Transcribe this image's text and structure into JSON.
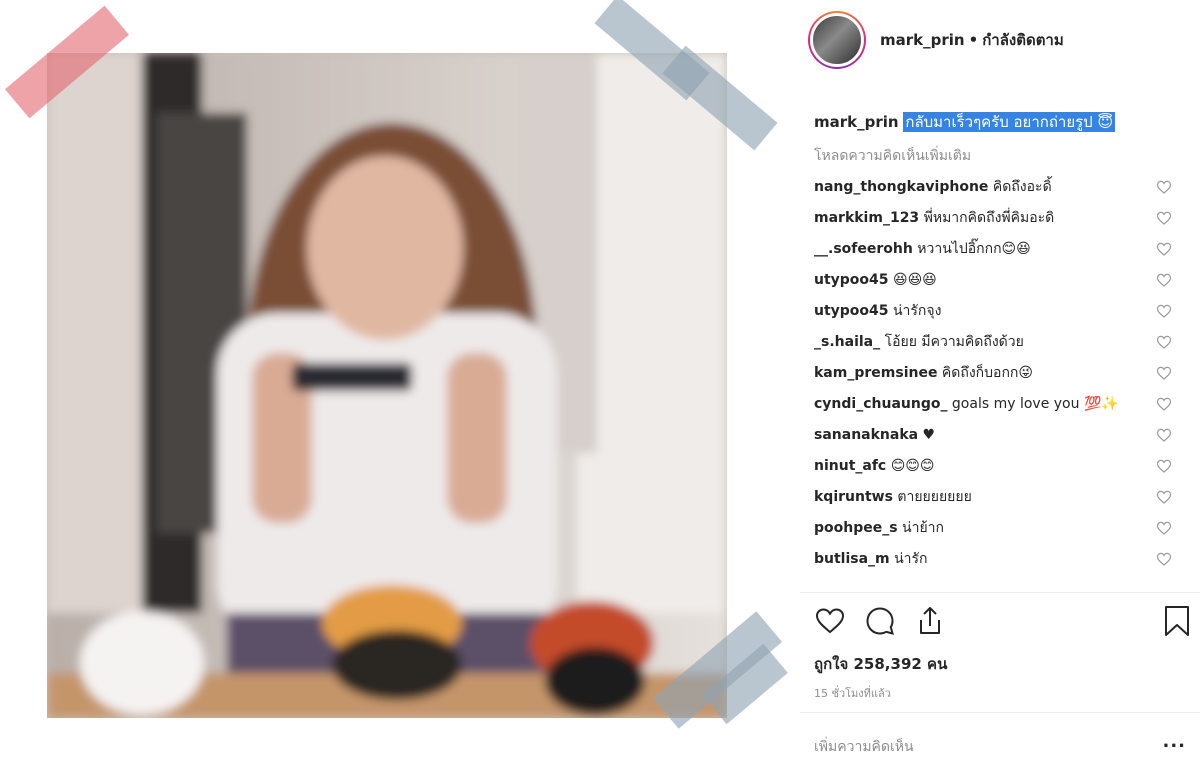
{
  "post": {
    "username": "mark_prin",
    "separator": "•",
    "follow_status": "กำลังติดตาม",
    "caption_text": "กลับมาเร็วๆครับ อยากถ่ายรูป 😇",
    "load_more": "โหลดความคิดเห็นเพิ่มเติม",
    "likes": "ถูกใจ 258,392 คน",
    "time": "15 ชั่วโมงที่แล้ว",
    "add_comment_placeholder": "เพิ่มความคิดเห็น",
    "more_icon": "..."
  },
  "comments": [
    {
      "user": "nang_thongkaviphone",
      "text": "คิดถึงอะดิ้"
    },
    {
      "user": "markkim_123",
      "text": "พี่หมากคิดถึงพี่คิมอะดิ"
    },
    {
      "user": "__.sofeerohh",
      "text": "หวานไปอิ๊กกก😊😆"
    },
    {
      "user": "utypoo45",
      "text": "😆😆😆"
    },
    {
      "user": "utypoo45",
      "text": "น่ารักจุง"
    },
    {
      "user": "_s.haila_",
      "text": "โอ้ยย มีความคิดถึงด้วย"
    },
    {
      "user": "kam_premsinee",
      "text": "คิดถึงก็บอกก😜"
    },
    {
      "user": "cyndi_chuaungo_",
      "text": "goals my love you 💯✨"
    },
    {
      "user": "sananaknaka",
      "text": "♥"
    },
    {
      "user": "ninut_afc",
      "text": "😊😊😊"
    },
    {
      "user": "kqiruntws",
      "text": "ตายยยยยยย"
    },
    {
      "user": "poohpee_s",
      "text": "น่าย้าก"
    },
    {
      "user": "butlisa_m",
      "text": "น่ารัก"
    }
  ],
  "icons": {
    "like": "heart-icon",
    "comment": "comment-icon",
    "share": "share-icon",
    "save": "bookmark-icon"
  },
  "colors": {
    "highlight": "#3584e4",
    "tape_red": "#e46a73",
    "tape_grey": "#8fa3b1",
    "muted_text": "#8e8e8e"
  }
}
